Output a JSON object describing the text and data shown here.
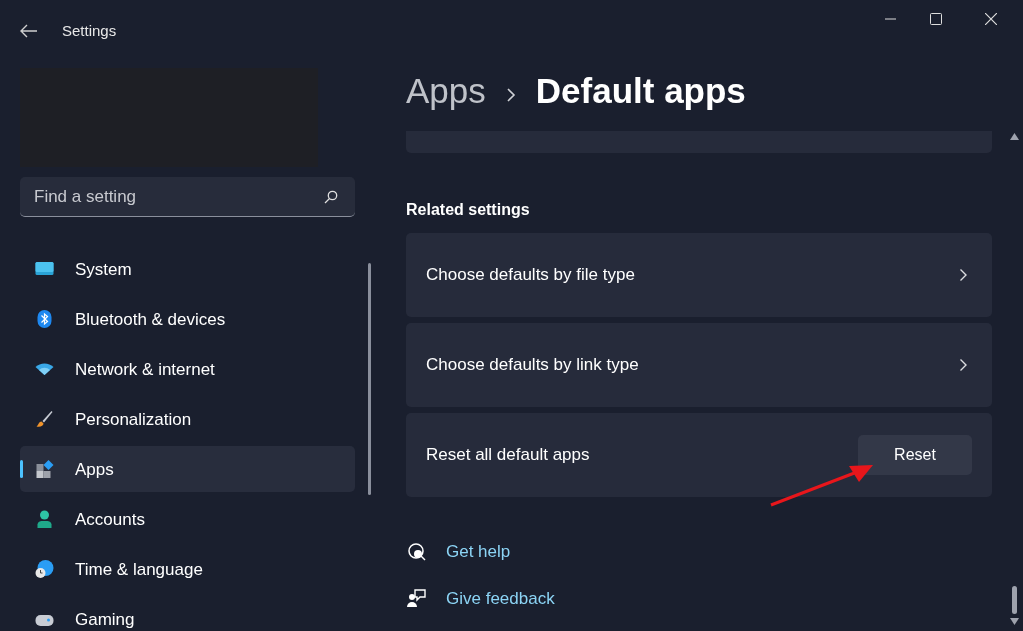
{
  "window": {
    "title": "Settings"
  },
  "search": {
    "placeholder": "Find a setting"
  },
  "nav": [
    {
      "label": "System",
      "kind": "system",
      "selected": false
    },
    {
      "label": "Bluetooth & devices",
      "kind": "bluetooth",
      "selected": false
    },
    {
      "label": "Network & internet",
      "kind": "network",
      "selected": false
    },
    {
      "label": "Personalization",
      "kind": "brush",
      "selected": false
    },
    {
      "label": "Apps",
      "kind": "apps",
      "selected": true
    },
    {
      "label": "Accounts",
      "kind": "accounts",
      "selected": false
    },
    {
      "label": "Time & language",
      "kind": "time",
      "selected": false
    },
    {
      "label": "Gaming",
      "kind": "gaming",
      "selected": false
    }
  ],
  "breadcrumb": {
    "parent": "Apps",
    "current": "Default apps"
  },
  "section": "Related settings",
  "settings": [
    {
      "label": "Choose defaults by file type",
      "kind": "link"
    },
    {
      "label": "Choose defaults by link type",
      "kind": "link"
    },
    {
      "label": "Reset all default apps",
      "kind": "button",
      "button": "Reset"
    }
  ],
  "help_links": [
    {
      "label": "Get help",
      "kind": "help"
    },
    {
      "label": "Give feedback",
      "kind": "feedback"
    }
  ]
}
